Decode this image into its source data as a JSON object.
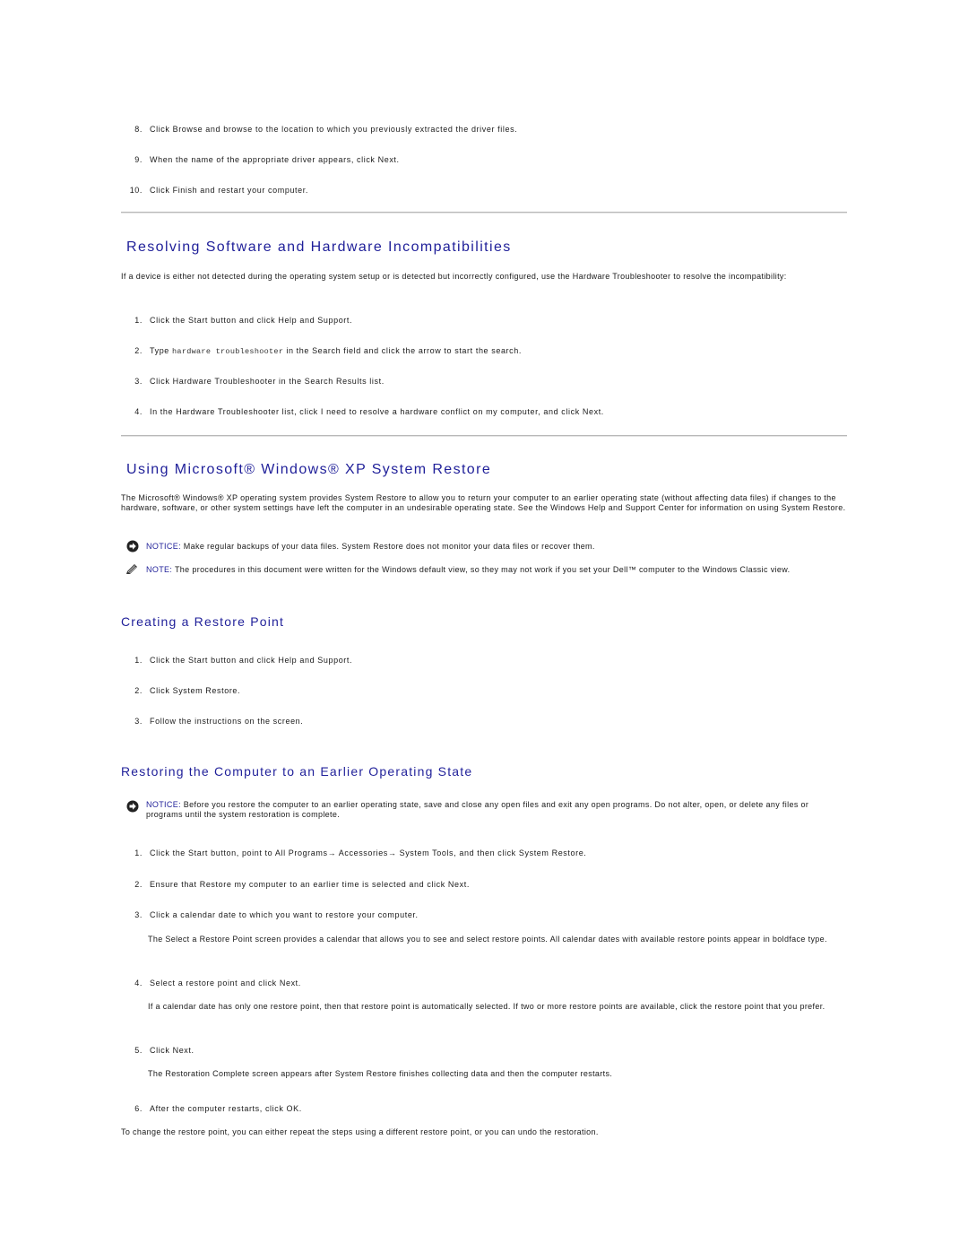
{
  "top_steps": [
    {
      "num": "8.",
      "text": "Click Browse and browse to the location to which you previously extracted the driver files."
    },
    {
      "num": "9.",
      "text": "When the name of the appropriate driver appears, click Next."
    },
    {
      "num": "10.",
      "text": "Click Finish and restart your computer."
    }
  ],
  "section_resolving": {
    "title": "Resolving Software and Hardware Incompatibilities",
    "intro": "If a device is either not detected during the operating system setup or is detected but incorrectly configured, use the Hardware Troubleshooter to resolve the incompatibility:",
    "steps": [
      {
        "num": "1.",
        "text": "Click the Start button and click Help and Support."
      },
      {
        "num": "2.",
        "pre": "Type ",
        "code": "hardware troubleshooter",
        "post": " in the Search field and click the arrow to start the search."
      },
      {
        "num": "3.",
        "text": "Click Hardware Troubleshooter in the Search Results list."
      },
      {
        "num": "4.",
        "text": "In the Hardware Troubleshooter list, click I need to resolve a hardware conflict on my computer, and click Next."
      }
    ]
  },
  "section_system_restore": {
    "title": "Using Microsoft® Windows® XP System Restore",
    "intro": "The Microsoft® Windows® XP operating system provides System Restore to allow you to return your computer to an earlier operating state (without affecting data files) if changes to the hardware, software, or other system settings have left the computer in an undesirable operating state. See the Windows Help and Support Center for information on using System Restore.",
    "notice": {
      "label": "NOTICE:",
      "text": " Make regular backups of your data files. System Restore does not monitor your data files or recover them."
    },
    "note": {
      "label": "NOTE:",
      "text": " The procedures in this document were written for the Windows default view, so they may not work if you set your Dell™ computer to the Windows Classic view."
    }
  },
  "section_creating": {
    "title": "Creating a Restore Point",
    "steps": [
      {
        "num": "1.",
        "text": "Click the Start button and click Help and Support."
      },
      {
        "num": "2.",
        "text": "Click System Restore."
      },
      {
        "num": "3.",
        "text": "Follow the instructions on the screen."
      }
    ]
  },
  "section_restoring": {
    "title": "Restoring the Computer to an Earlier Operating State",
    "notice": {
      "label": "NOTICE:",
      "text": " Before you restore the computer to an earlier operating state, save and close any open files and exit any open programs. Do not alter, open, or delete any files or programs until the system restoration is complete."
    },
    "steps": [
      {
        "num": "1.",
        "text": "Click the Start button, point to All Programs→ Accessories→ System Tools, and then click System Restore."
      },
      {
        "num": "2.",
        "text": "Ensure that Restore my computer to an earlier time is selected and click Next."
      },
      {
        "num": "3.",
        "text": "Click a calendar date to which you want to restore your computer.",
        "detail": "The Select a Restore Point screen provides a calendar that allows you to see and select restore points. All calendar dates with available restore points appear in boldface type."
      },
      {
        "num": "4.",
        "text": "Select a restore point and click Next.",
        "detail": "If a calendar date has only one restore point, then that restore point is automatically selected. If two or more restore points are available, click the restore point that you prefer."
      },
      {
        "num": "5.",
        "text": "Click Next.",
        "detail": "The Restoration Complete screen appears after System Restore finishes collecting data and then the computer restarts."
      },
      {
        "num": "6.",
        "text": "After the computer restarts, click OK."
      }
    ],
    "closing": "To change the restore point, you can either repeat the steps using a different restore point, or you can undo the restoration."
  }
}
